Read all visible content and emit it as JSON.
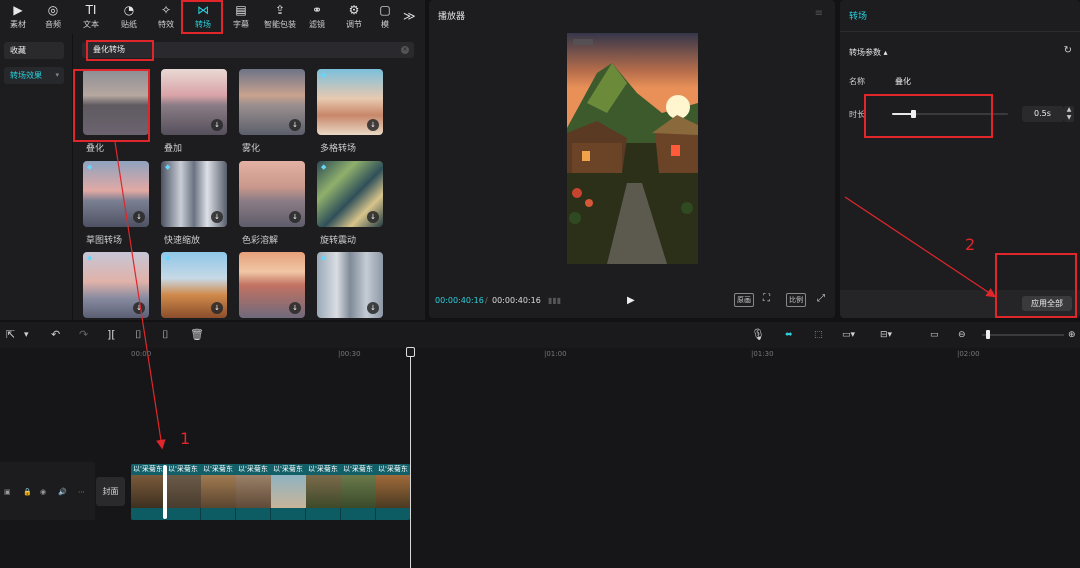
{
  "toolbar": {
    "items": [
      {
        "label": "素材",
        "icon": "media-icon"
      },
      {
        "label": "音频",
        "icon": "audio-icon"
      },
      {
        "label": "文本",
        "icon": "text-icon"
      },
      {
        "label": "贴纸",
        "icon": "sticker-icon"
      },
      {
        "label": "特效",
        "icon": "effects-icon"
      },
      {
        "label": "转场",
        "icon": "transition-icon"
      },
      {
        "label": "字幕",
        "icon": "subtitle-icon"
      },
      {
        "label": "智能包装",
        "icon": "smart-pack-icon"
      },
      {
        "label": "滤镜",
        "icon": "filter-icon"
      },
      {
        "label": "调节",
        "icon": "adjust-icon"
      },
      {
        "label": "模",
        "icon": "template-icon"
      }
    ],
    "active": "转场",
    "more": "≫"
  },
  "sidebar": {
    "items": [
      {
        "label": "收藏"
      },
      {
        "label": "转场效果",
        "selected": true
      }
    ]
  },
  "search": {
    "value": "叠化转场"
  },
  "gallery": {
    "items": [
      {
        "label": "叠化"
      },
      {
        "label": "叠加"
      },
      {
        "label": "雾化"
      },
      {
        "label": "多格转场"
      },
      {
        "label": "草图转场"
      },
      {
        "label": "快速缩放"
      },
      {
        "label": "色彩溶解"
      },
      {
        "label": "旋转震动"
      },
      {
        "label": ""
      },
      {
        "label": ""
      },
      {
        "label": ""
      },
      {
        "label": ""
      }
    ]
  },
  "player": {
    "title": "播放器",
    "timecode_current": "00:00:40:16",
    "timecode_sep": "/",
    "timecode_total": "00:00:40:16",
    "btn_original": "原画",
    "btn_ratio": "比例"
  },
  "props": {
    "title": "转场",
    "param_title": "转场参数 ▴",
    "name_label": "名称",
    "name_value": "叠化",
    "duration_label": "时长",
    "duration_value": "0.5s",
    "duration_fraction": 0.18,
    "apply_all": "应用全部"
  },
  "ruler": {
    "ticks": [
      "00:00",
      "|00:30",
      "|01:00",
      "|01:30",
      "|02:00"
    ]
  },
  "track": {
    "cover_label": "封面",
    "clip_label": "以'采菊东",
    "clips": 8
  },
  "annotations": {
    "one": "1",
    "two": "2"
  },
  "colors": {
    "accent": "#2ad1dc",
    "annotation": "#e0262b",
    "track": "#0d5c64"
  }
}
